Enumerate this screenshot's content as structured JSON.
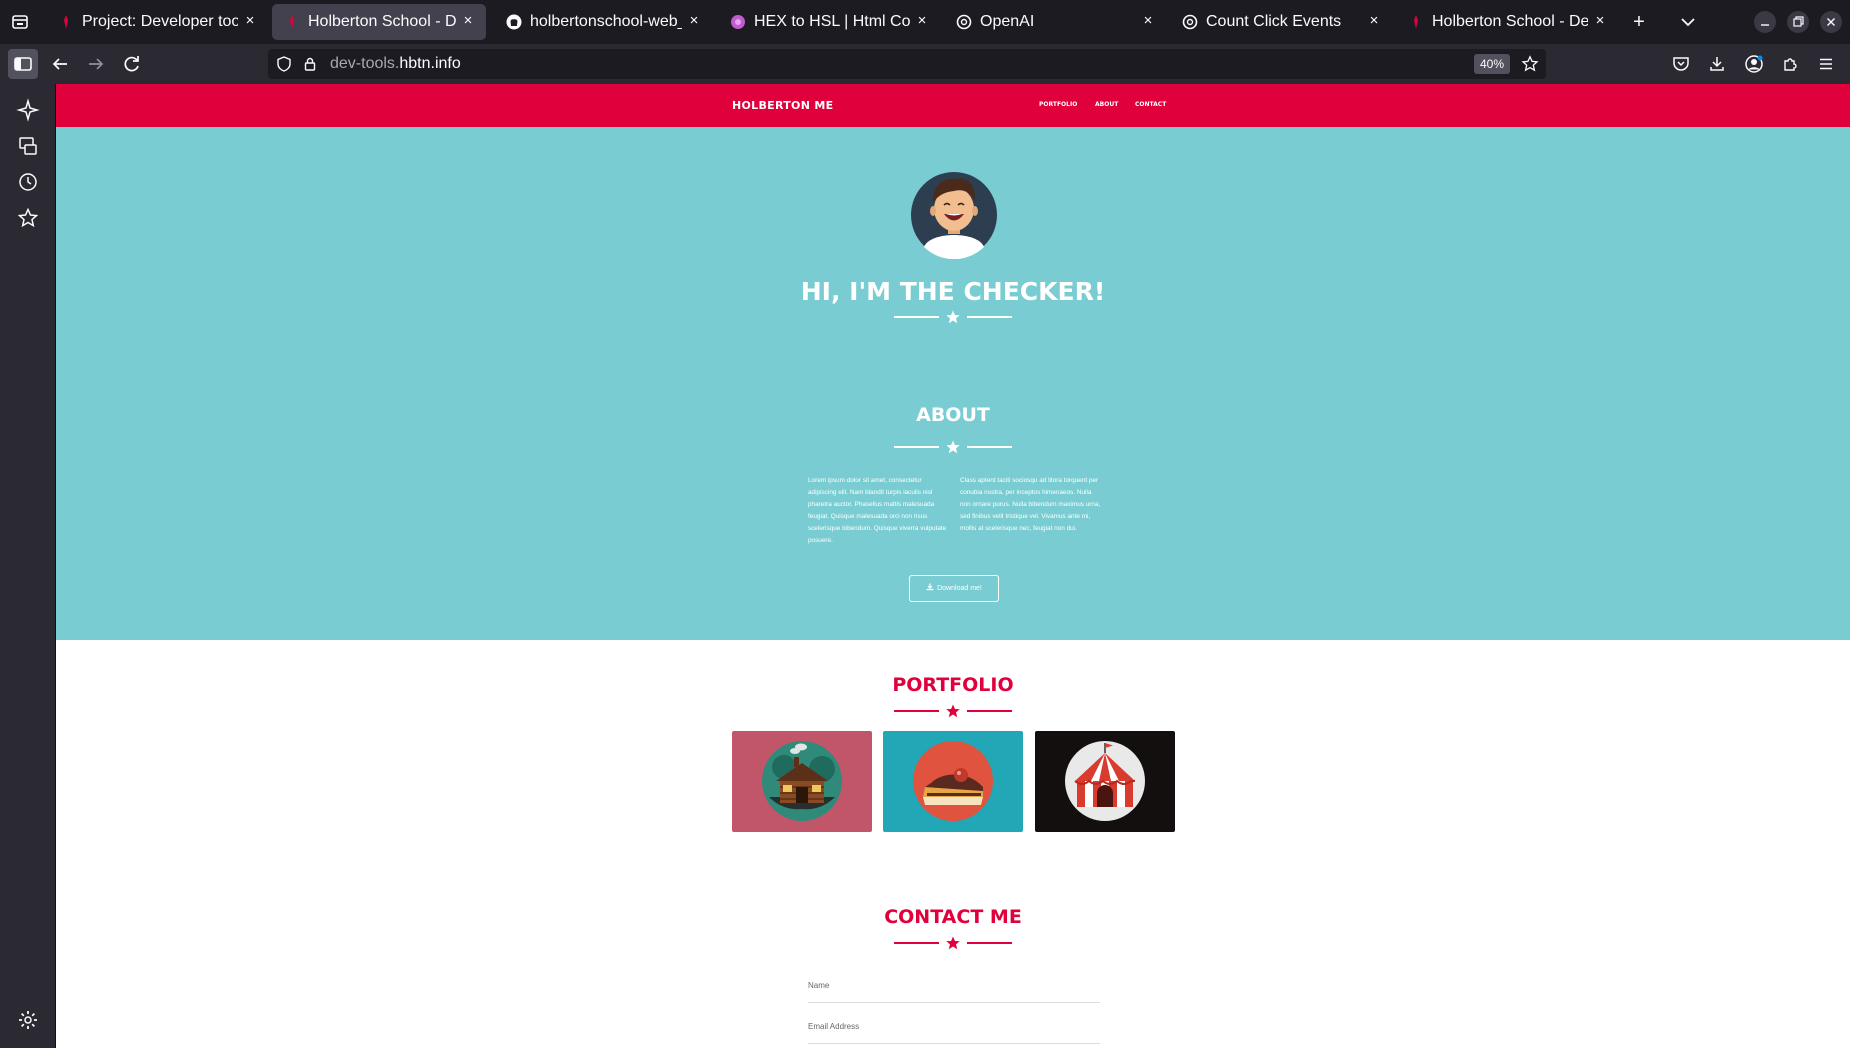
{
  "browser": {
    "tabs": [
      {
        "title": "Project: Developer tools |",
        "active": false
      },
      {
        "title": "Holberton School - Develo",
        "active": true
      },
      {
        "title": "holbertonschool-web_fro",
        "active": false
      },
      {
        "title": "HEX to HSL | Html Colors",
        "active": false
      },
      {
        "title": "OpenAI",
        "active": false
      },
      {
        "title": "Count Click Events",
        "active": false
      },
      {
        "title": "Holberton School - Develo",
        "active": false
      }
    ],
    "close_glyph": "×",
    "new_tab_glyph": "+",
    "url_prefix": "dev-tools.",
    "url_domain": "hbtn.info",
    "zoom": "40%"
  },
  "site": {
    "brand": "HOLBERTON ME",
    "menu": [
      "PORTFOLIO",
      "ABOUT",
      "CONTACT"
    ],
    "hero_title": "HI, I'M THE CHECKER!",
    "about": {
      "title": "ABOUT",
      "col1": "Lorem ipsum dolor sit amet, consectetur adipiscing elit. Nam blandit turpis iaculis nisl pharetra auctor. Phasellus mattis malesuada feugiat. Quisque malesuada orci non risus scelerisque bibendum. Quisque viverra vulputate posuere.",
      "col2": "Class aptent taciti sociosqu ad litora torquent per conubia nostra, per inceptos himenaeos. Nulla non ornare purus. Nulla bibendum maximus urna, sed finibus velit tristique vel. Vivamus ante mi, mollis at scelerisque nec, feugiat non dui.",
      "download_label": "Download me!"
    },
    "portfolio": {
      "title": "PORTFOLIO",
      "items": [
        {
          "icon": "cabin-icon",
          "bg": "#c1566a"
        },
        {
          "icon": "cake-icon",
          "bg": "#22a7b6"
        },
        {
          "icon": "circus-tent-icon",
          "bg": "#140f0f"
        }
      ]
    },
    "contact": {
      "title": "CONTACT ME",
      "name_placeholder": "Name",
      "email_placeholder": "Email Address"
    }
  },
  "colors": {
    "brand_red": "#e0003b",
    "hero_teal": "#79cdd2",
    "browser_dark": "#1c1b22",
    "toolbar": "#2b2a33"
  }
}
